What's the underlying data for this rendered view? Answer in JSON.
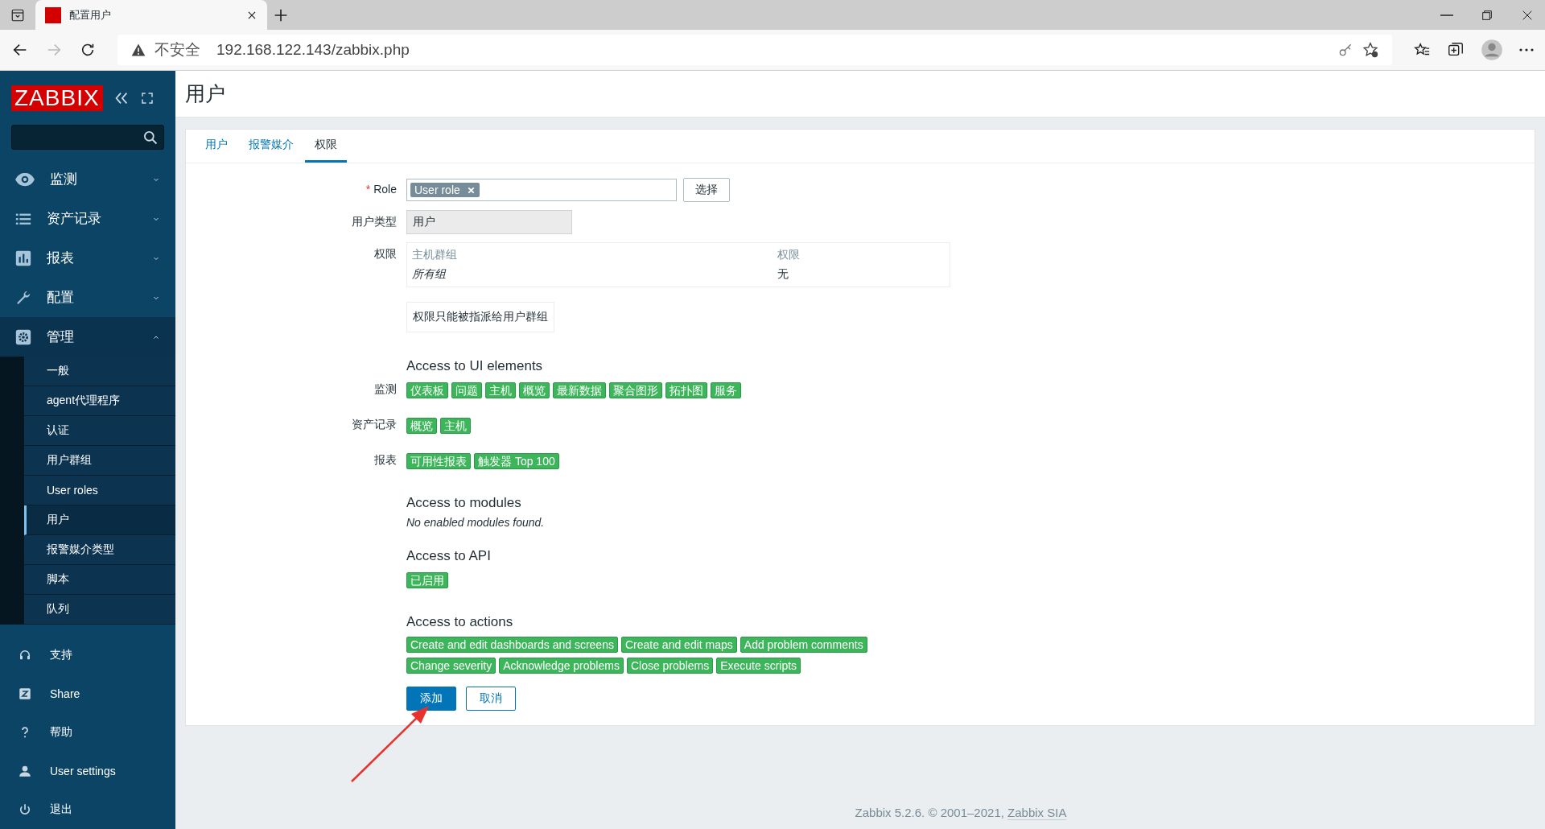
{
  "browser": {
    "tab_title": "配置用户",
    "security": "不安全",
    "url": "192.168.122.143/zabbix.php"
  },
  "sidebar": {
    "logo": "ZABBIX",
    "menu": [
      {
        "label": "监测",
        "expanded": false
      },
      {
        "label": "资产记录",
        "expanded": false
      },
      {
        "label": "报表",
        "expanded": false
      },
      {
        "label": "配置",
        "expanded": false
      },
      {
        "label": "管理",
        "expanded": true,
        "children": [
          {
            "label": "一般",
            "selected": false
          },
          {
            "label": "agent代理程序",
            "selected": false
          },
          {
            "label": "认证",
            "selected": false
          },
          {
            "label": "用户群组",
            "selected": false
          },
          {
            "label": "User roles",
            "selected": false
          },
          {
            "label": "用户",
            "selected": true
          },
          {
            "label": "报警媒介类型",
            "selected": false
          },
          {
            "label": "脚本",
            "selected": false
          },
          {
            "label": "队列",
            "selected": false
          }
        ]
      }
    ],
    "bottom": [
      "支持",
      "Share",
      "帮助",
      "User settings",
      "退出"
    ]
  },
  "page_title": "用户",
  "tabs": [
    {
      "label": "用户",
      "selected": false
    },
    {
      "label": "报警媒介",
      "selected": false
    },
    {
      "label": "权限",
      "selected": true
    }
  ],
  "form": {
    "role": {
      "required_mark": "*",
      "label": "Role",
      "tag": "User role",
      "button": "选择"
    },
    "user_type": {
      "label": "用户类型",
      "value": "用户"
    },
    "permissions": {
      "label": "权限",
      "columns": [
        "主机群组",
        "权限"
      ],
      "rows": [
        {
          "group": "所有组",
          "permission": "无"
        }
      ]
    },
    "note": "权限只能被指派给用户群组",
    "ui_access": {
      "title": "Access to UI elements",
      "groups": [
        {
          "label": "监测",
          "tags": [
            "仪表板",
            "问题",
            "主机",
            "概览",
            "最新数据",
            "聚合图形",
            "拓扑图",
            "服务"
          ]
        },
        {
          "label": "资产记录",
          "tags": [
            "概览",
            "主机"
          ]
        },
        {
          "label": "报表",
          "tags": [
            "可用性报表",
            "触发器 Top 100"
          ]
        }
      ]
    },
    "modules": {
      "title": "Access to modules",
      "message": "No enabled modules found."
    },
    "api": {
      "title": "Access to API",
      "tags": [
        "已启用"
      ]
    },
    "actions": {
      "title": "Access to actions",
      "tags": [
        "Create and edit dashboards and screens",
        "Create and edit maps",
        "Add problem comments",
        "Change severity",
        "Acknowledge problems",
        "Close problems",
        "Execute scripts"
      ]
    },
    "buttons": [
      {
        "label": "添加",
        "kind": "primary"
      },
      {
        "label": "取消",
        "kind": "secondary"
      }
    ]
  },
  "footer": {
    "text": "Zabbix 5.2.6. © 2001–2021, ",
    "link": "Zabbix SIA"
  }
}
